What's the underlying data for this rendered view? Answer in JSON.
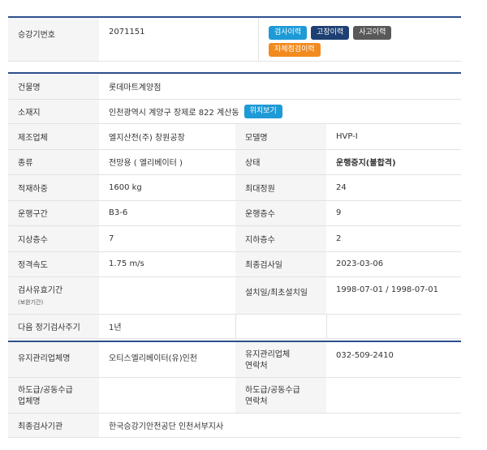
{
  "top": {
    "label": "승강기번호",
    "value": "2071151",
    "buttons": [
      {
        "label": "검사이력",
        "color": "#1e9ad6"
      },
      {
        "label": "고장이력",
        "color": "#1d3f72"
      },
      {
        "label": "사고이력",
        "color": "#595959"
      },
      {
        "label": "자체점검이력",
        "color": "#f28a1e"
      }
    ]
  },
  "detail": {
    "building_label": "건물명",
    "building_value": "롯데마트계양점",
    "address_label": "소재지",
    "address_value": "인천광역시 계양구 장제로 822 계산동",
    "map_button": "위치보기",
    "map_button_color": "#1e9ad6",
    "rows": [
      {
        "l1": "제조업체",
        "v1": "엘지산전(주) 창원공장",
        "l2": "모델명",
        "v2": "HVP-Ⅰ"
      },
      {
        "l1": "종류",
        "v1": "전망용 ( 엘리베이터 )",
        "l2": "상태",
        "v2": "운행중지(불합격)"
      },
      {
        "l1": "적재하중",
        "v1": "1600 kg",
        "l2": "최대정원",
        "v2": "24"
      },
      {
        "l1": "운행구간",
        "v1": "B3-6",
        "l2": "운행층수",
        "v2": "9"
      },
      {
        "l1": "지상층수",
        "v1": "7",
        "l2": "지하층수",
        "v2": "2"
      },
      {
        "l1": "정격속도",
        "v1": "1.75 m/s",
        "l2": "최종검사일",
        "v2": "2023-03-06"
      }
    ],
    "validity_label": "검사유효기간",
    "validity_sub": "(보완기간)",
    "validity_value": "",
    "install_label": "설치일/최초설치일",
    "install_value": "1998-07-01 / 1998-07-01",
    "next_label": "다음 정기검사주기",
    "next_value": "1년"
  },
  "maint": {
    "company_label": "유지관리업체명",
    "company_value": "오티스엘리베이터(유)인천",
    "contact_label_1": "유지관리업체",
    "contact_label_2": "연락처",
    "contact_value": "032-509-2410",
    "sub_label_1": "하도급/공동수급",
    "sub_label_2": "업체명",
    "sub_value": "",
    "sub_contact_label_1": "하도급/공동수급",
    "sub_contact_label_2": "연락처",
    "sub_contact_value": "",
    "agency_label": "최종검사기관",
    "agency_value": "한국승강기안전공단 인천서부지사"
  }
}
